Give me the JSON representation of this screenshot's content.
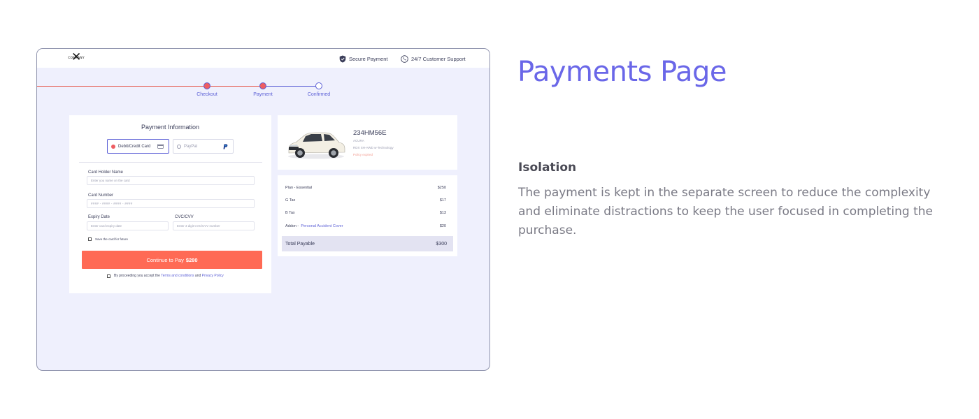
{
  "header": {
    "logo_text": "COMPANY",
    "secure_label": "Secure Payment",
    "support_label": "24/7 Customer Support"
  },
  "stepper": {
    "steps": [
      {
        "label": "Checkout",
        "state": "done"
      },
      {
        "label": "Payment",
        "state": "current"
      },
      {
        "label": "Confirmed",
        "state": "pending"
      }
    ]
  },
  "payment": {
    "title": "Payment Information",
    "methods": [
      {
        "label": "Debit/Credit Card",
        "selected": true
      },
      {
        "label": "PayPal",
        "selected": false
      }
    ],
    "card_holder": {
      "label": "Card Holder Name",
      "placeholder": "Enter you name on the card"
    },
    "card_number": {
      "label": "Card Number",
      "placeholder": "#### - #### - #### - ####"
    },
    "expiry": {
      "label": "Expiry Date",
      "placeholder": "Enter card expiry date"
    },
    "cvc": {
      "label": "CVC/CVV",
      "placeholder": "Enter 3 digit CVC/CVV number"
    },
    "save_card_label": "Save the card for future",
    "pay_button_prefix": "Continue to Pay",
    "pay_button_amount": "$280",
    "terms_prefix": "By proceeding you accept the",
    "terms_link": "Terms and conditions",
    "terms_and": "and",
    "privacy_link": "Privacy Policy"
  },
  "vehicle": {
    "plate": "234HM56E",
    "make": "ACURA",
    "model": "RDX SH-AWD w-Technology",
    "status": "Policy expired"
  },
  "summary": {
    "rows": [
      {
        "label": "Plan - Essential",
        "link": "",
        "amount": "$250"
      },
      {
        "label": "G Tax",
        "link": "",
        "amount": "$17"
      },
      {
        "label": "B Tax",
        "link": "",
        "amount": "$13"
      },
      {
        "label": "Addon - ",
        "link": "Personal Accident Cover",
        "amount": "$20"
      }
    ],
    "total_label": "Total Payable",
    "total_amount": "$300"
  },
  "description": {
    "heading": "Payments Page",
    "subheading": "Isolation",
    "body": "The payment is kept in the separate screen to reduce the complexity and eliminate distractions to keep the user focused in completing the purchase."
  },
  "colors": {
    "accent": "#5b5fd6",
    "cta": "#ff6a55",
    "heading": "#6a67e8",
    "canvas": "#eff0fd"
  }
}
